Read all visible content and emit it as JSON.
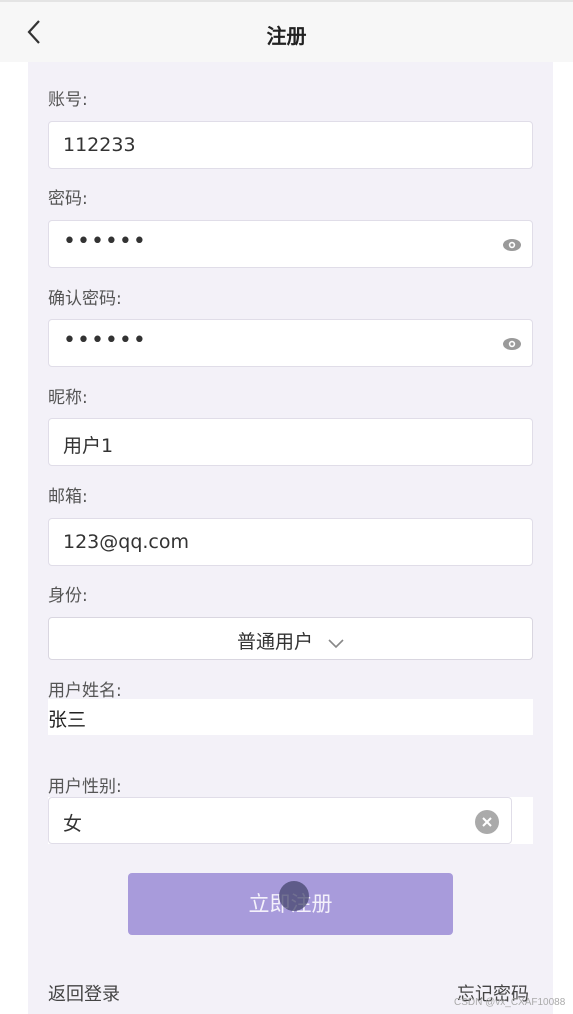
{
  "header": {
    "title": "注册",
    "back_icon": "chevron-left-icon"
  },
  "form": {
    "account": {
      "label": "账号:",
      "value": "112233"
    },
    "password": {
      "label": "密码:",
      "value": "••••••",
      "icon": "eye-icon"
    },
    "confirm": {
      "label": "确认密码:",
      "value": "••••••",
      "icon": "eye-icon"
    },
    "nickname": {
      "label": "昵称:",
      "value": "用户1"
    },
    "email": {
      "label": "邮箱:",
      "value": "123@qq.com"
    },
    "role": {
      "label": "身份:",
      "value": "普通用户",
      "icon": "chevron-down-icon"
    },
    "realname": {
      "label": "用户姓名:",
      "value": "张三"
    },
    "gender": {
      "label": "用户性别:",
      "value": "女",
      "icon": "clear-icon"
    },
    "submit_label": "立即注册"
  },
  "footer": {
    "back_login": "返回登录",
    "forgot": "忘记密码",
    "watermark": "CSDN @vx_CXAF10088"
  },
  "colors": {
    "accent": "#a89bdb",
    "background": "#f3f1f8"
  }
}
